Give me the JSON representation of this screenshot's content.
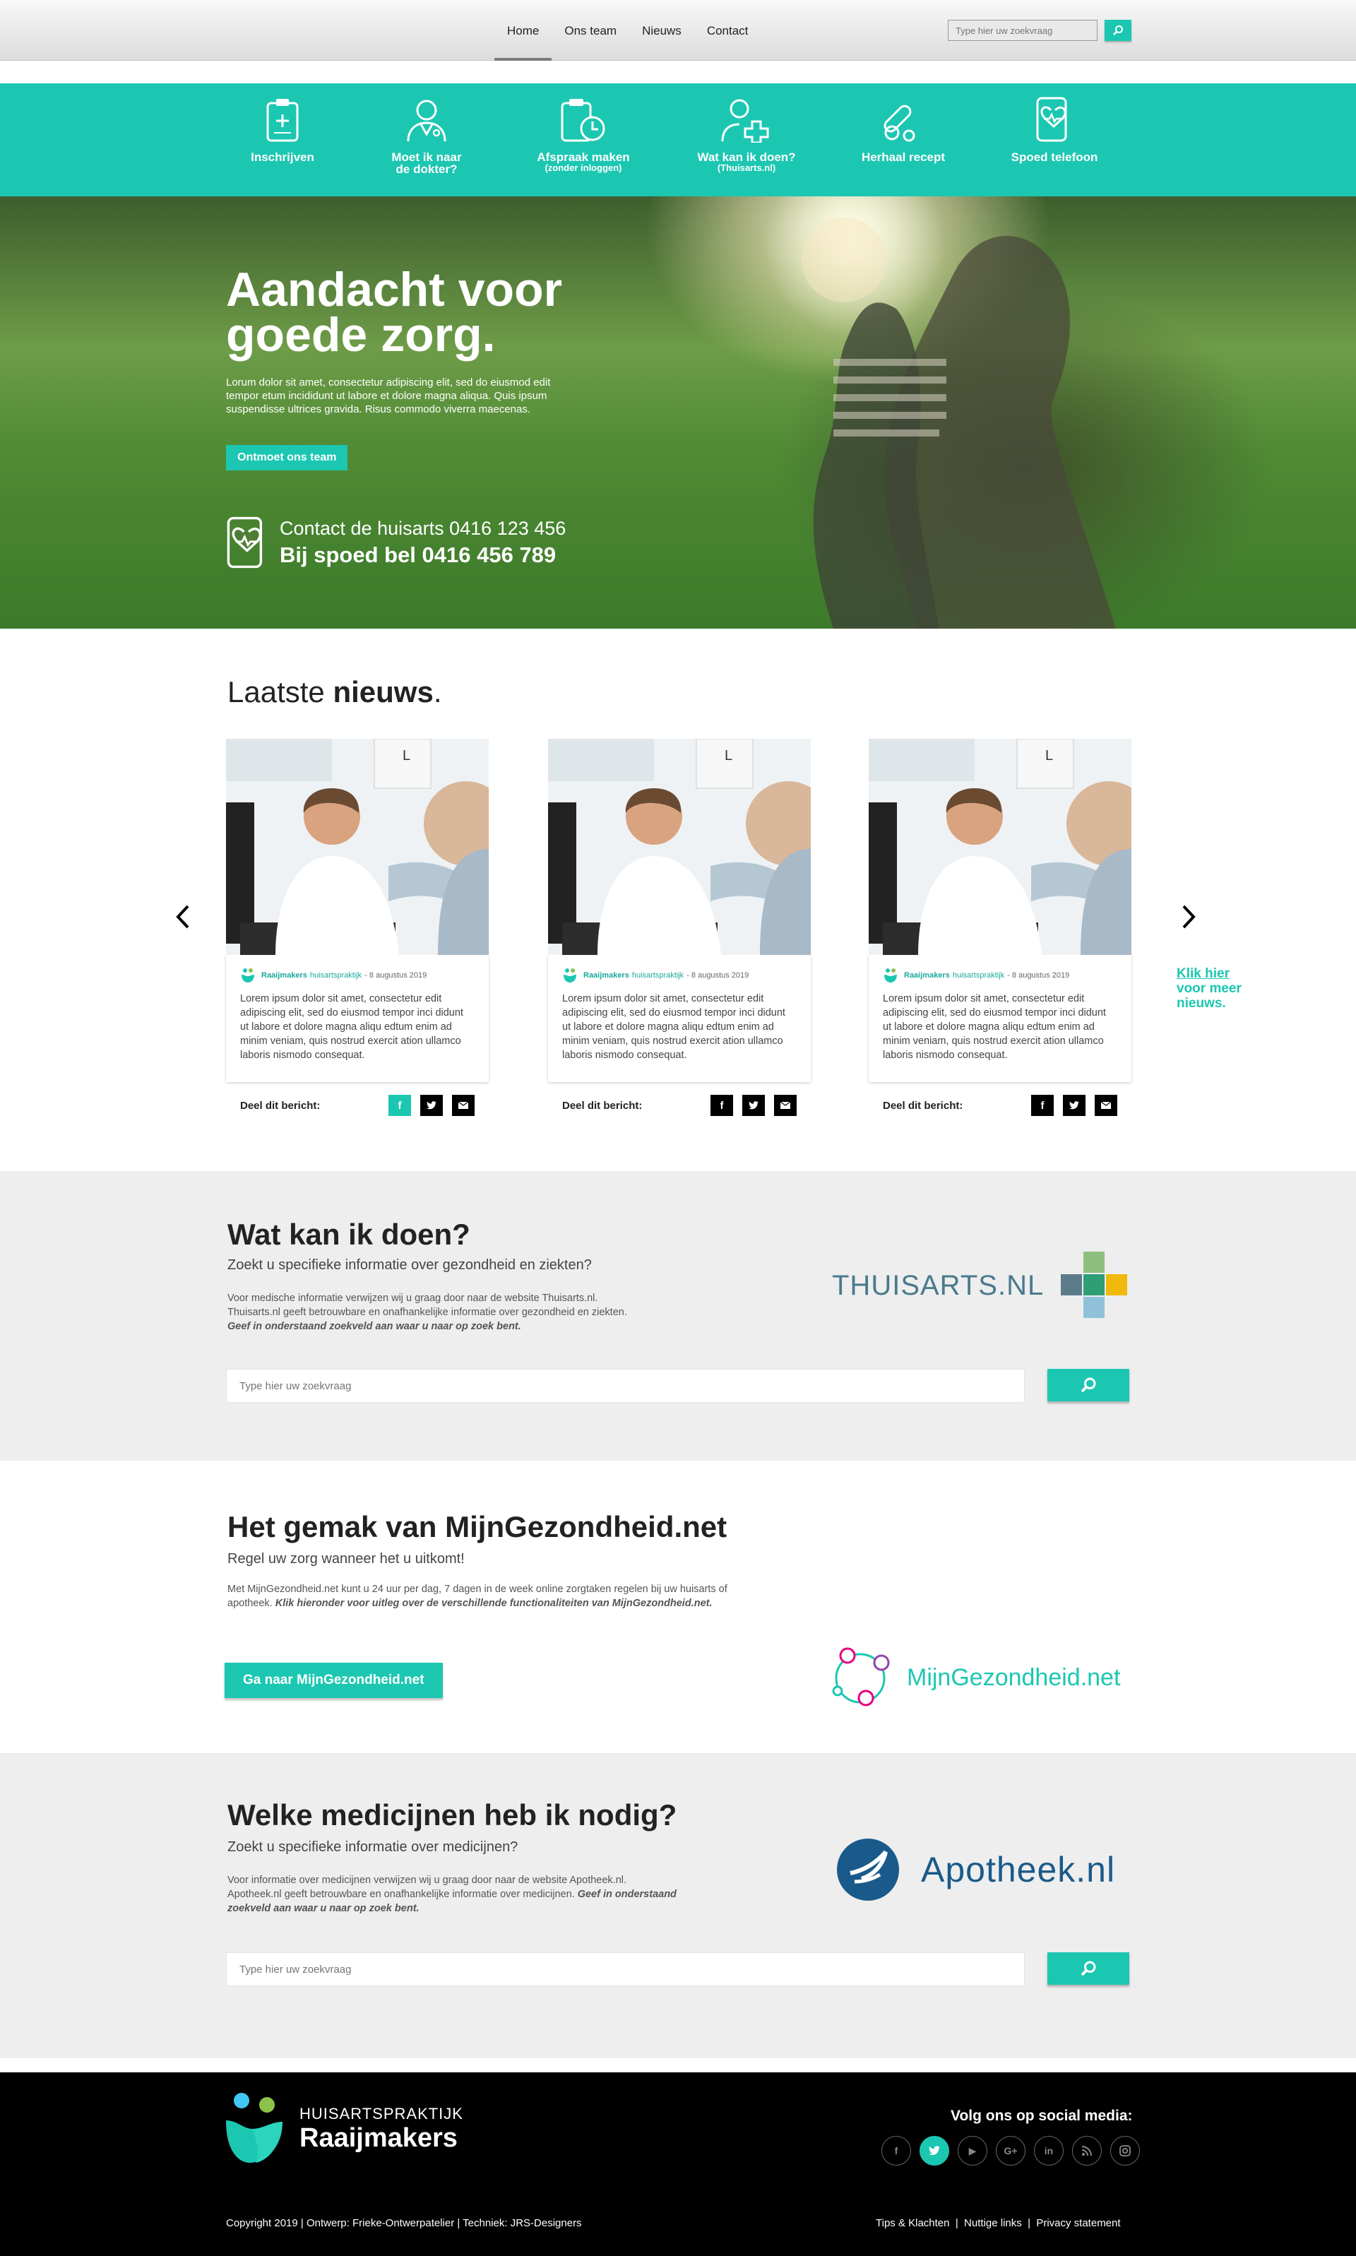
{
  "nav": {
    "items": [
      "Home",
      "Ons team",
      "Nieuws",
      "Contact"
    ],
    "search_placeholder": "Type hier uw zoekvraag"
  },
  "iconbar": [
    {
      "label": "Inschrijven",
      "sub": "",
      "icon": "clipboard-icon"
    },
    {
      "label": "Moet ik naar",
      "label2": "de dokter?",
      "sub": "",
      "icon": "doctor-icon"
    },
    {
      "label": "Afspraak maken",
      "sub": "(zonder inloggen)",
      "icon": "appointment-icon"
    },
    {
      "label": "Wat kan ik doen?",
      "sub": "(Thuisarts.nl)",
      "icon": "medical-cross-icon"
    },
    {
      "label": "Herhaal recept",
      "sub": "",
      "icon": "pills-icon"
    },
    {
      "label": "Spoed telefoon",
      "sub": "",
      "icon": "emergency-phone-icon"
    }
  ],
  "hero": {
    "title1": "Aandacht voor",
    "title2": "goede zorg.",
    "lead": "Lorum dolor sit amet, consectetur adipiscing elit, sed do eiusmod edit tempor etum incididunt ut labore et dolore magna aliqua. Quis ipsum suspendisse ultrices gravida. Risus commodo viverra maecenas.",
    "cta": "Ontmoet ons team",
    "contact_line": "Contact de huisarts 0416 123 456",
    "emergency_line": "Bij spoed bel 0416 456 789"
  },
  "news": {
    "title_light": "Laatste ",
    "title_bold": "nieuws",
    "title_end": ".",
    "cards": [
      {
        "author": "Raaijmakers",
        "type": "huisartspraktijk",
        "date": "- 8 augustus 2019",
        "text": "Lorem ipsum dolor sit amet, consectetur edit adipiscing elit, sed do eiusmod tempor inci didunt ut labore et dolore magna aliqu edtum enim ad minim veniam, quis nostrud exercit ation ullamco laboris nismodo consequat.",
        "share_label": "Deel dit bericht:"
      },
      {
        "author": "Raaijmakers",
        "type": "huisartspraktijk",
        "date": "- 8 augustus 2019",
        "text": "Lorem ipsum dolor sit amet, consectetur edit adipiscing elit, sed do eiusmod tempor inci didunt ut labore et dolore magna aliqu edtum enim ad minim veniam, quis nostrud exercit ation ullamco laboris nismodo consequat.",
        "share_label": "Deel dit bericht:"
      },
      {
        "author": "Raaijmakers",
        "type": "huisartspraktijk",
        "date": "- 8 augustus 2019",
        "text": "Lorem ipsum dolor sit amet, consectetur edit adipiscing elit, sed do eiusmod tempor inci didunt ut labore et dolore magna aliqu edtum enim ad minim veniam, quis nostrud exercit ation ullamco laboris nismodo consequat.",
        "share_label": "Deel dit bericht:"
      }
    ],
    "more1": "Klik hier",
    "more2": "voor meer",
    "more3": "nieuws."
  },
  "thuisarts": {
    "title": "Wat kan ik doen?",
    "subtitle": "Zoekt u specifieke informatie over gezondheid en ziekten?",
    "p1": "Voor medische informatie verwijzen wij u graag door naar de website Thuisarts.nl.",
    "p2": "Thuisarts.nl geeft betrouwbare en onafhankelijke informatie over gezondheid en ziekten.",
    "p3": "Geef in onderstaand zoekveld aan waar u naar op zoek bent.",
    "logo_text": "THUISARTS.NL",
    "search_placeholder": "Type hier uw zoekvraag"
  },
  "mijngezondheid": {
    "title": "Het gemak van MijnGezondheid.net",
    "subtitle": "Regel uw zorg wanneer het u uitkomt!",
    "p1": "Met MijnGezondheid.net kunt u 24 uur per dag, 7 dagen in de week online zorgtaken regelen bij uw huisarts of apotheek. ",
    "p2": "Klik hieronder voor uitleg over de verschillende functionaliteiten van MijnGezondheid.net.",
    "button": "Ga naar MijnGezondheid.net",
    "logo_text": "MijnGezondheid.net"
  },
  "apotheek": {
    "title": "Welke medicijnen heb ik nodig?",
    "subtitle": "Zoekt u specifieke informatie over medicijnen?",
    "p1": "Voor informatie over medicijnen verwijzen wij u graag door naar de website Apotheek.nl. Apotheek.nl geeft betrouwbare en onafhankelijke informatie over medicijnen. ",
    "p2": "Geef in onderstaand zoekveld aan waar u naar op zoek bent.",
    "logo_text": "Apotheek.nl",
    "search_placeholder": "Type hier uw zoekvraag"
  },
  "footer": {
    "brand_top": "HUISARTSPRAKTIJK",
    "brand_name": "Raaijmakers",
    "social_title": "Volg ons op social media:",
    "socials": [
      "f",
      "t",
      "▶",
      "G+",
      "in",
      "rss",
      "ig"
    ],
    "copyright": "Copyright 2019 | Ontwerp: Frieke-Ontwerpatelier | Techniek: JRS-Designers",
    "links": "Tips & Klachten  |  Nuttige links  |  Privacy statement"
  },
  "colors": {
    "accent": "#1cc7b2",
    "footer": "#000000",
    "gray_section": "#eeeeee"
  }
}
